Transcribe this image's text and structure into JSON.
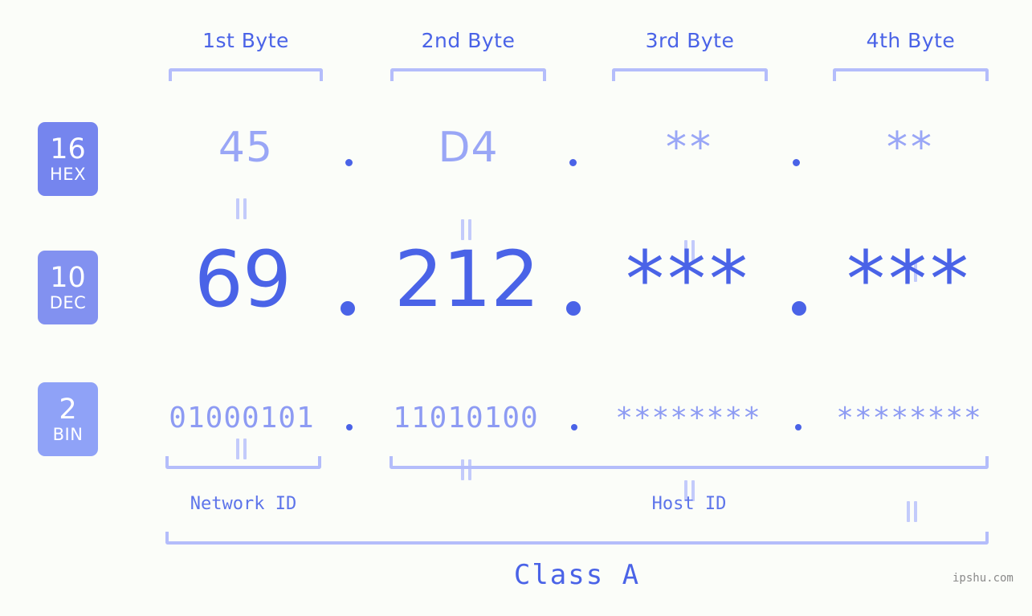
{
  "background": "#fbfdf9",
  "colors": {
    "accent_strong": "#4a63e7",
    "accent_mid": "#8d9bf3",
    "accent_light": "#b4bdfb",
    "badge_hex": "#7585ee",
    "badge_dec": "#8291f0",
    "badge_bin": "#8fa2f7"
  },
  "byte_headers": [
    {
      "label": "1st Byte"
    },
    {
      "label": "2nd Byte"
    },
    {
      "label": "3rd Byte"
    },
    {
      "label": "4th Byte"
    }
  ],
  "bases": [
    {
      "number": "16",
      "abbr": "HEX"
    },
    {
      "number": "10",
      "abbr": "DEC"
    },
    {
      "number": "2",
      "abbr": "BIN"
    }
  ],
  "rows": {
    "hex": {
      "base_number": "16",
      "base_abbr": "HEX",
      "values": [
        "45",
        "D4",
        "**",
        "**"
      ]
    },
    "dec": {
      "base_number": "10",
      "base_abbr": "DEC",
      "values": [
        "69",
        "212",
        "***",
        "***"
      ]
    },
    "bin": {
      "base_number": "2",
      "base_abbr": "BIN",
      "values": [
        "01000101",
        "11010100",
        "********",
        "********"
      ]
    }
  },
  "separator": ".",
  "equals_symbol": "=",
  "segments": {
    "network_id": "Network ID",
    "host_id": "Host ID",
    "class": "Class A"
  },
  "watermark": "ipshu.com"
}
